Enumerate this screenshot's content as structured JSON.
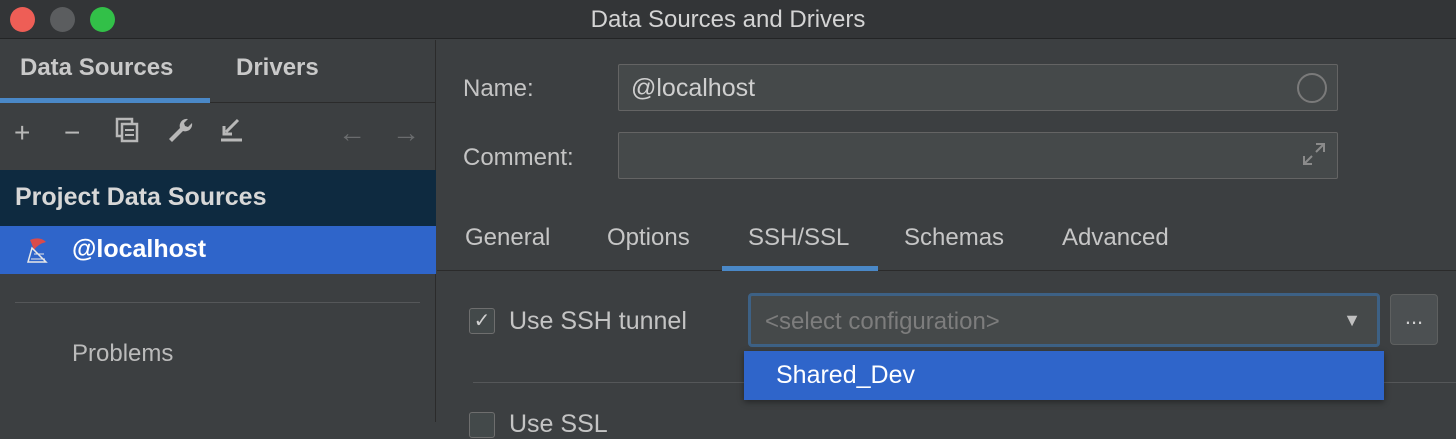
{
  "window": {
    "title": "Data Sources and Drivers"
  },
  "left_panel": {
    "tabs": [
      "Data Sources",
      "Drivers"
    ],
    "toolbar": {
      "add": "+",
      "remove": "−",
      "copy": "⧉",
      "wrench": "🔧",
      "import": "↙",
      "back": "←",
      "forward": "→"
    },
    "section_header": "Project Data Sources",
    "selected_item": "@localhost",
    "problems": "Problems"
  },
  "right_panel": {
    "name_label": "Name:",
    "name_value": "@localhost",
    "comment_label": "Comment:",
    "comment_value": "",
    "tabs": [
      "General",
      "Options",
      "SSH/SSL",
      "Schemas",
      "Advanced"
    ],
    "active_tab": "SSH/SSL",
    "ssh": {
      "label": "Use SSH tunnel",
      "checked": true,
      "placeholder": "<select configuration>",
      "more_label": "...",
      "dropdown_options": [
        "Shared_Dev"
      ]
    },
    "ssl": {
      "label": "Use SSL"
    }
  },
  "colors": {
    "accent": "#4a88c7",
    "selection": "#2f65ca",
    "background": "#3c3f41"
  }
}
